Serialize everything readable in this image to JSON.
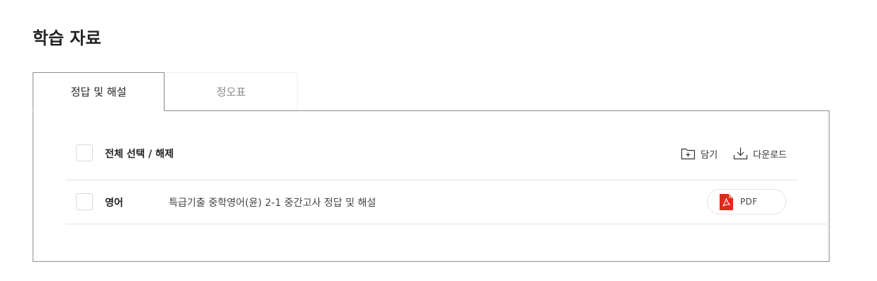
{
  "page": {
    "title": "학습 자료"
  },
  "tabs": [
    {
      "label": "정답 및 해설",
      "active": true
    },
    {
      "label": "정오표",
      "active": false
    }
  ],
  "toolbar": {
    "select_all_label": "전체 선택 / 해제",
    "save_label": "담기",
    "download_label": "다운로드"
  },
  "items": [
    {
      "subject": "영어",
      "title": "특급기출 중학영어(윤) 2-1 중간고사 정답 및 해설",
      "file_button_label": "PDF",
      "file_icon": "pdf-icon"
    }
  ],
  "colors": {
    "pdf_red": "#e0291b",
    "panel_border": "#8e8e8e",
    "divider": "#e2e2e2",
    "inactive_tab_text": "#8a8a8a"
  }
}
